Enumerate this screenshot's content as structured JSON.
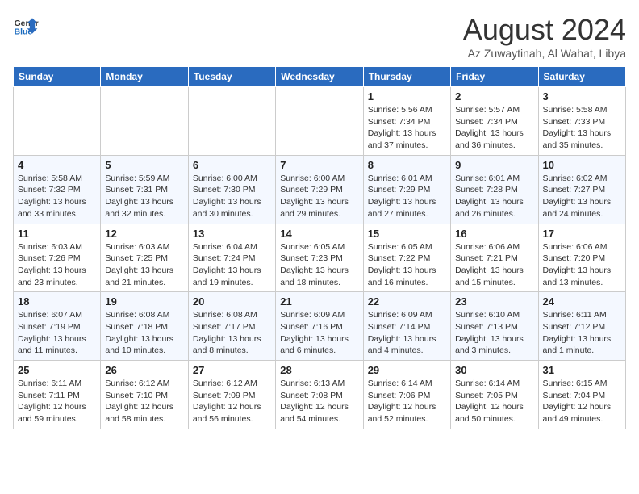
{
  "logo": {
    "line1": "General",
    "line2": "Blue"
  },
  "title": "August 2024",
  "location": "Az Zuwaytinah, Al Wahat, Libya",
  "days_of_week": [
    "Sunday",
    "Monday",
    "Tuesday",
    "Wednesday",
    "Thursday",
    "Friday",
    "Saturday"
  ],
  "weeks": [
    [
      {
        "day": "",
        "info": ""
      },
      {
        "day": "",
        "info": ""
      },
      {
        "day": "",
        "info": ""
      },
      {
        "day": "",
        "info": ""
      },
      {
        "day": "1",
        "info": "Sunrise: 5:56 AM\nSunset: 7:34 PM\nDaylight: 13 hours\nand 37 minutes."
      },
      {
        "day": "2",
        "info": "Sunrise: 5:57 AM\nSunset: 7:34 PM\nDaylight: 13 hours\nand 36 minutes."
      },
      {
        "day": "3",
        "info": "Sunrise: 5:58 AM\nSunset: 7:33 PM\nDaylight: 13 hours\nand 35 minutes."
      }
    ],
    [
      {
        "day": "4",
        "info": "Sunrise: 5:58 AM\nSunset: 7:32 PM\nDaylight: 13 hours\nand 33 minutes."
      },
      {
        "day": "5",
        "info": "Sunrise: 5:59 AM\nSunset: 7:31 PM\nDaylight: 13 hours\nand 32 minutes."
      },
      {
        "day": "6",
        "info": "Sunrise: 6:00 AM\nSunset: 7:30 PM\nDaylight: 13 hours\nand 30 minutes."
      },
      {
        "day": "7",
        "info": "Sunrise: 6:00 AM\nSunset: 7:29 PM\nDaylight: 13 hours\nand 29 minutes."
      },
      {
        "day": "8",
        "info": "Sunrise: 6:01 AM\nSunset: 7:29 PM\nDaylight: 13 hours\nand 27 minutes."
      },
      {
        "day": "9",
        "info": "Sunrise: 6:01 AM\nSunset: 7:28 PM\nDaylight: 13 hours\nand 26 minutes."
      },
      {
        "day": "10",
        "info": "Sunrise: 6:02 AM\nSunset: 7:27 PM\nDaylight: 13 hours\nand 24 minutes."
      }
    ],
    [
      {
        "day": "11",
        "info": "Sunrise: 6:03 AM\nSunset: 7:26 PM\nDaylight: 13 hours\nand 23 minutes."
      },
      {
        "day": "12",
        "info": "Sunrise: 6:03 AM\nSunset: 7:25 PM\nDaylight: 13 hours\nand 21 minutes."
      },
      {
        "day": "13",
        "info": "Sunrise: 6:04 AM\nSunset: 7:24 PM\nDaylight: 13 hours\nand 19 minutes."
      },
      {
        "day": "14",
        "info": "Sunrise: 6:05 AM\nSunset: 7:23 PM\nDaylight: 13 hours\nand 18 minutes."
      },
      {
        "day": "15",
        "info": "Sunrise: 6:05 AM\nSunset: 7:22 PM\nDaylight: 13 hours\nand 16 minutes."
      },
      {
        "day": "16",
        "info": "Sunrise: 6:06 AM\nSunset: 7:21 PM\nDaylight: 13 hours\nand 15 minutes."
      },
      {
        "day": "17",
        "info": "Sunrise: 6:06 AM\nSunset: 7:20 PM\nDaylight: 13 hours\nand 13 minutes."
      }
    ],
    [
      {
        "day": "18",
        "info": "Sunrise: 6:07 AM\nSunset: 7:19 PM\nDaylight: 13 hours\nand 11 minutes."
      },
      {
        "day": "19",
        "info": "Sunrise: 6:08 AM\nSunset: 7:18 PM\nDaylight: 13 hours\nand 10 minutes."
      },
      {
        "day": "20",
        "info": "Sunrise: 6:08 AM\nSunset: 7:17 PM\nDaylight: 13 hours\nand 8 minutes."
      },
      {
        "day": "21",
        "info": "Sunrise: 6:09 AM\nSunset: 7:16 PM\nDaylight: 13 hours\nand 6 minutes."
      },
      {
        "day": "22",
        "info": "Sunrise: 6:09 AM\nSunset: 7:14 PM\nDaylight: 13 hours\nand 4 minutes."
      },
      {
        "day": "23",
        "info": "Sunrise: 6:10 AM\nSunset: 7:13 PM\nDaylight: 13 hours\nand 3 minutes."
      },
      {
        "day": "24",
        "info": "Sunrise: 6:11 AM\nSunset: 7:12 PM\nDaylight: 13 hours\nand 1 minute."
      }
    ],
    [
      {
        "day": "25",
        "info": "Sunrise: 6:11 AM\nSunset: 7:11 PM\nDaylight: 12 hours\nand 59 minutes."
      },
      {
        "day": "26",
        "info": "Sunrise: 6:12 AM\nSunset: 7:10 PM\nDaylight: 12 hours\nand 58 minutes."
      },
      {
        "day": "27",
        "info": "Sunrise: 6:12 AM\nSunset: 7:09 PM\nDaylight: 12 hours\nand 56 minutes."
      },
      {
        "day": "28",
        "info": "Sunrise: 6:13 AM\nSunset: 7:08 PM\nDaylight: 12 hours\nand 54 minutes."
      },
      {
        "day": "29",
        "info": "Sunrise: 6:14 AM\nSunset: 7:06 PM\nDaylight: 12 hours\nand 52 minutes."
      },
      {
        "day": "30",
        "info": "Sunrise: 6:14 AM\nSunset: 7:05 PM\nDaylight: 12 hours\nand 50 minutes."
      },
      {
        "day": "31",
        "info": "Sunrise: 6:15 AM\nSunset: 7:04 PM\nDaylight: 12 hours\nand 49 minutes."
      }
    ]
  ]
}
